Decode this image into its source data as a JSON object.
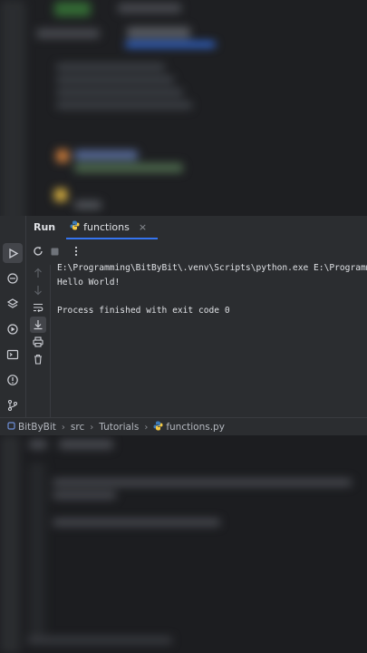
{
  "run_panel": {
    "title": "Run",
    "tab": {
      "label": "functions",
      "close": "×"
    }
  },
  "console": {
    "lines": [
      "E:\\Programming\\BitByBit\\.venv\\Scripts\\python.exe E:\\Programming\\BitByBit\\src\\Tutorials\\functions.py",
      "Hello World!",
      "",
      "Process finished with exit code 0"
    ]
  },
  "breadcrumb": {
    "items": [
      "BitByBit",
      "src",
      "Tutorials",
      "functions.py"
    ]
  },
  "colors": {
    "panel": "#2b2d30",
    "editor": "#1e1f22",
    "accent": "#3574f0",
    "python_blue": "#3d7ab8",
    "python_yellow": "#f5c842"
  },
  "icons": {
    "strip": [
      "run-icon",
      "python-console-icon",
      "layers-icon",
      "services-icon",
      "terminal-icon",
      "problems-icon",
      "git-icon"
    ],
    "toolbar": [
      "rerun-icon",
      "stop-icon",
      "more-icon"
    ],
    "side": [
      "scroll-up-icon",
      "scroll-down-icon",
      "soft-wrap-icon",
      "scroll-to-end-icon",
      "print-icon",
      "clear-all-icon"
    ]
  }
}
